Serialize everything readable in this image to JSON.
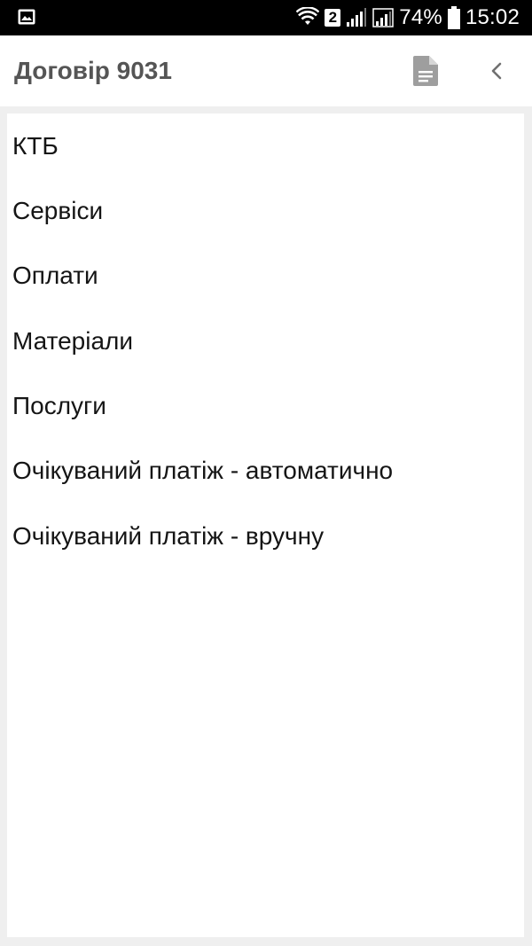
{
  "status_bar": {
    "sim_slot": "2",
    "battery_percent": "74%",
    "time": "15:02",
    "icons": [
      "image-notification-icon",
      "wifi-icon",
      "signal-icon",
      "battery-icon"
    ]
  },
  "app_bar": {
    "title": "Договір 9031",
    "icons": [
      "document-icon",
      "chevron-left-icon"
    ]
  },
  "menu": {
    "items": [
      {
        "label": "КТБ"
      },
      {
        "label": "Сервіси"
      },
      {
        "label": "Оплати"
      },
      {
        "label": "Матеріали"
      },
      {
        "label": "Послуги"
      },
      {
        "label": "Очікуваний платіж - автоматично"
      },
      {
        "label": "Очікуваний платіж - вручну"
      }
    ]
  },
  "colors": {
    "status_bar_bg": "#000000",
    "app_bar_bg": "#ffffff",
    "page_bg": "#efefef",
    "title_text": "#555555",
    "item_text": "#151515",
    "icon_gray": "#9e9e9e"
  }
}
